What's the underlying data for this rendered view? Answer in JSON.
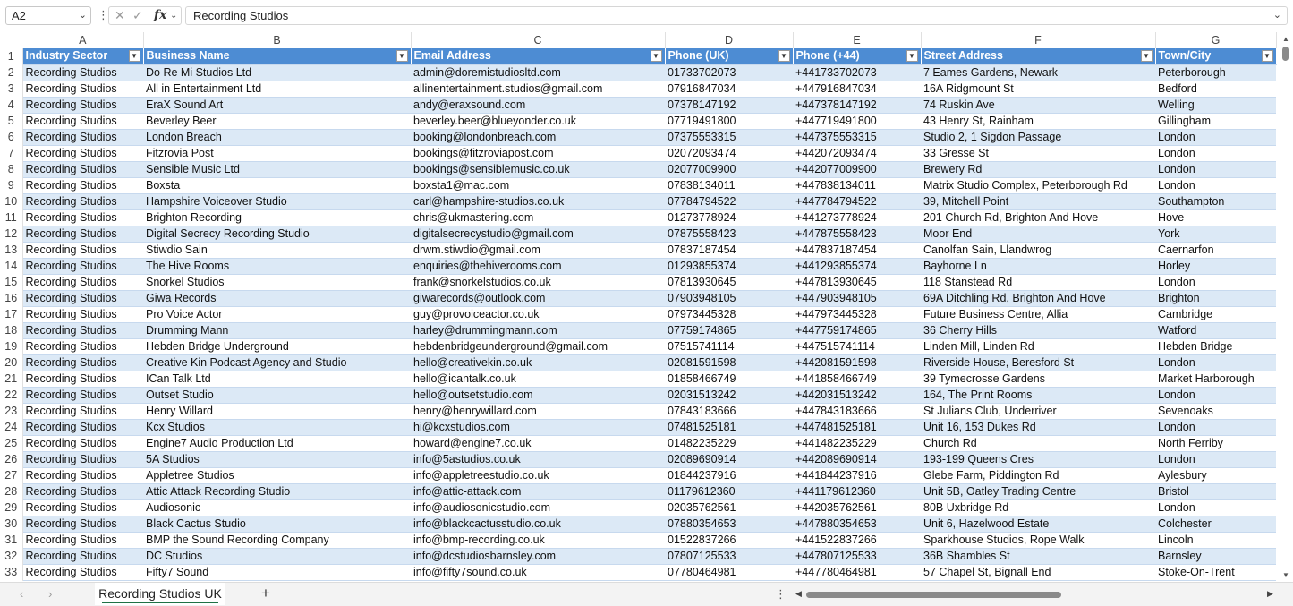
{
  "formula_bar": {
    "cell_ref": "A2",
    "formula_value": "Recording Studios",
    "cancel_icon": "x-icon",
    "enter_icon": "check-icon",
    "function_icon": "fx-icon"
  },
  "columns": [
    "A",
    "B",
    "C",
    "D",
    "E",
    "F",
    "G"
  ],
  "headers": [
    "Industry Sector",
    "Business Name",
    "Email Address",
    "Phone (UK)",
    "Phone (+44)",
    "Street Address",
    "Town/City"
  ],
  "rows": [
    [
      "Recording Studios",
      "Do Re Mi Studios Ltd",
      "admin@doremistudiosltd.com",
      "01733702073",
      "+441733702073",
      "7 Eames Gardens, Newark",
      "Peterborough"
    ],
    [
      "Recording Studios",
      "All in Entertainment Ltd",
      "allinentertainment.studios@gmail.com",
      "07916847034",
      "+447916847034",
      "16A Ridgmount St",
      "Bedford"
    ],
    [
      "Recording Studios",
      "EraX Sound Art",
      "andy@eraxsound.com",
      "07378147192",
      "+447378147192",
      "74 Ruskin Ave",
      "Welling"
    ],
    [
      "Recording Studios",
      "Beverley Beer",
      "beverley.beer@blueyonder.co.uk",
      "07719491800",
      "+447719491800",
      "43 Henry St, Rainham",
      "Gillingham"
    ],
    [
      "Recording Studios",
      "London Breach",
      "booking@londonbreach.com",
      "07375553315",
      "+447375553315",
      "Studio 2, 1 Sigdon Passage",
      "London"
    ],
    [
      "Recording Studios",
      "Fitzrovia Post",
      "bookings@fitzroviapost.com",
      "02072093474",
      "+442072093474",
      "33 Gresse St",
      "London"
    ],
    [
      "Recording Studios",
      "Sensible Music Ltd",
      "bookings@sensiblemusic.co.uk",
      "02077009900",
      "+442077009900",
      "Brewery Rd",
      "London"
    ],
    [
      "Recording Studios",
      "Boxsta",
      "boxsta1@mac.com",
      "07838134011",
      "+447838134011",
      "Matrix Studio Complex, Peterborough Rd",
      "London"
    ],
    [
      "Recording Studios",
      "Hampshire Voiceover Studio",
      "carl@hampshire-studios.co.uk",
      "07784794522",
      "+447784794522",
      "39, Mitchell Point",
      "Southampton"
    ],
    [
      "Recording Studios",
      "Brighton Recording",
      "chris@ukmastering.com",
      "01273778924",
      "+441273778924",
      "201 Church Rd, Brighton And Hove",
      "Hove"
    ],
    [
      "Recording Studios",
      "Digital Secrecy Recording Studio",
      "digitalsecrecystudio@gmail.com",
      "07875558423",
      "+447875558423",
      "Moor End",
      "York"
    ],
    [
      "Recording Studios",
      "Stiwdio Sain",
      "drwm.stiwdio@gmail.com",
      "07837187454",
      "+447837187454",
      "Canolfan Sain, Llandwrog",
      "Caernarfon"
    ],
    [
      "Recording Studios",
      "The Hive Rooms",
      "enquiries@thehiverooms.com",
      "01293855374",
      "+441293855374",
      "Bayhorne Ln",
      "Horley"
    ],
    [
      "Recording Studios",
      "Snorkel Studios",
      "frank@snorkelstudios.co.uk",
      "07813930645",
      "+447813930645",
      "118 Stanstead Rd",
      "London"
    ],
    [
      "Recording Studios",
      "Giwa Records",
      "giwarecords@outlook.com",
      "07903948105",
      "+447903948105",
      "69A Ditchling Rd, Brighton And Hove",
      "Brighton"
    ],
    [
      "Recording Studios",
      "Pro Voice Actor",
      "guy@provoiceactor.co.uk",
      "07973445328",
      "+447973445328",
      "Future Business Centre, Allia",
      "Cambridge"
    ],
    [
      "Recording Studios",
      "Drumming Mann",
      "harley@drummingmann.com",
      "07759174865",
      "+447759174865",
      "36 Cherry Hills",
      "Watford"
    ],
    [
      "Recording Studios",
      "Hebden Bridge Underground",
      "hebdenbridgeunderground@gmail.com",
      "07515741114",
      "+447515741114",
      "Linden Mill, Linden Rd",
      "Hebden Bridge"
    ],
    [
      "Recording Studios",
      "Creative Kin Podcast Agency and Studio",
      "hello@creativekin.co.uk",
      "02081591598",
      "+442081591598",
      "Riverside House, Beresford St",
      "London"
    ],
    [
      "Recording Studios",
      "ICan Talk Ltd",
      "hello@icantalk.co.uk",
      "01858466749",
      "+441858466749",
      "39 Tymecrosse Gardens",
      "Market Harborough"
    ],
    [
      "Recording Studios",
      "Outset Studio",
      "hello@outsetstudio.com",
      "02031513242",
      "+442031513242",
      "164, The Print Rooms",
      "London"
    ],
    [
      "Recording Studios",
      "Henry Willard",
      "henry@henrywillard.com",
      "07843183666",
      "+447843183666",
      "St Julians Club, Underriver",
      "Sevenoaks"
    ],
    [
      "Recording Studios",
      "Kcx Studios",
      "hi@kcxstudios.com",
      "07481525181",
      "+447481525181",
      "Unit 16, 153 Dukes Rd",
      "London"
    ],
    [
      "Recording Studios",
      "Engine7 Audio Production Ltd",
      "howard@engine7.co.uk",
      "01482235229",
      "+441482235229",
      "Church Rd",
      "North Ferriby"
    ],
    [
      "Recording Studios",
      "5A Studios",
      "info@5astudios.co.uk",
      "02089690914",
      "+442089690914",
      "193-199 Queens Cres",
      "London"
    ],
    [
      "Recording Studios",
      "Appletree Studios",
      "info@appletreestudio.co.uk",
      "01844237916",
      "+441844237916",
      "Glebe Farm, Piddington Rd",
      "Aylesbury"
    ],
    [
      "Recording Studios",
      "Attic Attack Recording Studio",
      "info@attic-attack.com",
      "01179612360",
      "+441179612360",
      "Unit 5B, Oatley Trading Centre",
      "Bristol"
    ],
    [
      "Recording Studios",
      "Audiosonic",
      "info@audiosonicstudio.com",
      "02035762561",
      "+442035762561",
      "80B Uxbridge Rd",
      "London"
    ],
    [
      "Recording Studios",
      "Black Cactus Studio",
      "info@blackcactusstudio.co.uk",
      "07880354653",
      "+447880354653",
      "Unit 6, Hazelwood Estate",
      "Colchester"
    ],
    [
      "Recording Studios",
      "BMP the Sound Recording Company",
      "info@bmp-recording.co.uk",
      "01522837266",
      "+441522837266",
      "Sparkhouse Studios, Rope Walk",
      "Lincoln"
    ],
    [
      "Recording Studios",
      "DC Studios",
      "info@dcstudiosbarnsley.com",
      "07807125533",
      "+447807125533",
      "36B Shambles St",
      "Barnsley"
    ],
    [
      "Recording Studios",
      "Fifty7 Sound",
      "info@fifty7sound.co.uk",
      "07780464981",
      "+447780464981",
      "57 Chapel St, Bignall End",
      "Stoke-On-Trent"
    ]
  ],
  "sheet_tabs": {
    "active": "Recording Studios UK",
    "add_label": "+"
  }
}
